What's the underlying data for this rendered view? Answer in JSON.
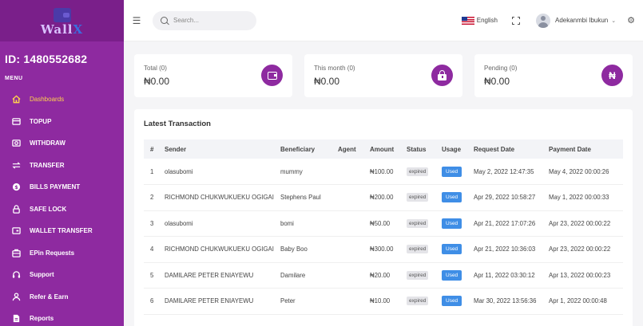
{
  "sidebar": {
    "logo_text_a": "Wall",
    "logo_text_x": "X",
    "user_id": "ID: 1480552682",
    "menu_label": "MENU",
    "items": [
      {
        "label": "Dashboards",
        "icon": "home-icon",
        "active": true
      },
      {
        "label": "TOPUP",
        "icon": "topup-icon"
      },
      {
        "label": "WITHDRAW",
        "icon": "withdraw-icon"
      },
      {
        "label": "TRANSFER",
        "icon": "transfer-icon"
      },
      {
        "label": "BILLS PAYMENT",
        "icon": "bills-icon"
      },
      {
        "label": "SAFE LOCK",
        "icon": "lock-icon"
      },
      {
        "label": "WALLET TRANSFER",
        "icon": "wallet-transfer-icon"
      },
      {
        "label": "EPin Requests",
        "icon": "epin-icon"
      },
      {
        "label": "Support",
        "icon": "support-icon"
      },
      {
        "label": "Refer & Earn",
        "icon": "refer-icon"
      },
      {
        "label": "Reports",
        "icon": "reports-icon"
      }
    ]
  },
  "topbar": {
    "search_placeholder": "Search...",
    "language": "English",
    "user_name": "Adekanmbi Ibukun"
  },
  "cards": [
    {
      "label": "Total (0)",
      "value": "₦0.00",
      "icon": "wallet-icon"
    },
    {
      "label": "This month (0)",
      "value": "₦0.00",
      "icon": "lock-icon"
    },
    {
      "label": "Pending (0)",
      "value": "₦0.00",
      "icon": "naira-icon",
      "glyph": "₦"
    }
  ],
  "transactions": {
    "title": "Latest Transaction",
    "columns": [
      "#",
      "Sender",
      "Beneficiary",
      "Agent",
      "Amount",
      "Status",
      "Usage",
      "Request Date",
      "Payment Date"
    ],
    "rows": [
      {
        "n": "1",
        "sender": "olasubomi",
        "beneficiary": "mummy",
        "agent": "",
        "amount": "₦100.00",
        "status": "expired",
        "usage": "Used",
        "request_date": "May 2, 2022 12:47:35",
        "payment_date": "May 4, 2022 00:00:26"
      },
      {
        "n": "2",
        "sender": "RICHMOND CHUKWUKUEKU OGIGAI",
        "beneficiary": "Stephens Paul",
        "agent": "",
        "amount": "₦200.00",
        "status": "expired",
        "usage": "Used",
        "request_date": "Apr 29, 2022 10:58:27",
        "payment_date": "May 1, 2022 00:00:33"
      },
      {
        "n": "3",
        "sender": "olasubomi",
        "beneficiary": "bomi",
        "agent": "",
        "amount": "₦50.00",
        "status": "expired",
        "usage": "Used",
        "request_date": "Apr 21, 2022 17:07:26",
        "payment_date": "Apr 23, 2022 00:00:22"
      },
      {
        "n": "4",
        "sender": "RICHMOND CHUKWUKUEKU OGIGAI",
        "beneficiary": "Baby Boo",
        "agent": "",
        "amount": "₦300.00",
        "status": "expired",
        "usage": "Used",
        "request_date": "Apr 21, 2022 10:36:03",
        "payment_date": "Apr 23, 2022 00:00:22"
      },
      {
        "n": "5",
        "sender": "DAMILARE PETER ENIAYEWU",
        "beneficiary": "Damilare",
        "agent": "",
        "amount": "₦20.00",
        "status": "expired",
        "usage": "Used",
        "request_date": "Apr 11, 2022 03:30:12",
        "payment_date": "Apr 13, 2022 00:00:23"
      },
      {
        "n": "6",
        "sender": "DAMILARE PETER ENIAYEWU",
        "beneficiary": "Peter",
        "agent": "",
        "amount": "₦10.00",
        "status": "expired",
        "usage": "Used",
        "request_date": "Mar 30, 2022 13:56:36",
        "payment_date": "Apr 1, 2022 00:00:48"
      }
    ]
  },
  "colors": {
    "sidebar": "#8e2aa0",
    "accent_active": "#ffd24d",
    "used_badge": "#3f8ee6"
  }
}
